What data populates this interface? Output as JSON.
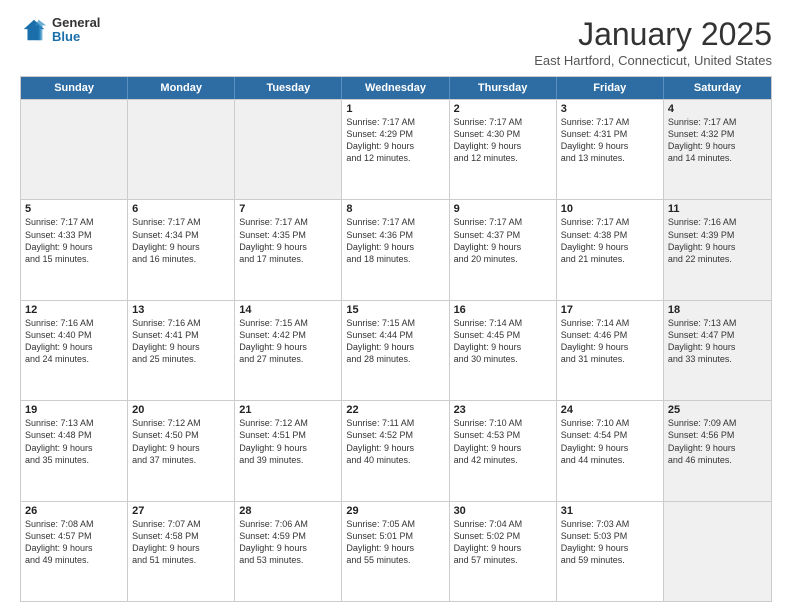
{
  "header": {
    "logo_general": "General",
    "logo_blue": "Blue",
    "month_title": "January 2025",
    "subtitle": "East Hartford, Connecticut, United States"
  },
  "days_of_week": [
    "Sunday",
    "Monday",
    "Tuesday",
    "Wednesday",
    "Thursday",
    "Friday",
    "Saturday"
  ],
  "weeks": [
    [
      {
        "num": "",
        "info": "",
        "shaded": true
      },
      {
        "num": "",
        "info": "",
        "shaded": true
      },
      {
        "num": "",
        "info": "",
        "shaded": true
      },
      {
        "num": "1",
        "info": "Sunrise: 7:17 AM\nSunset: 4:29 PM\nDaylight: 9 hours\nand 12 minutes.",
        "shaded": false
      },
      {
        "num": "2",
        "info": "Sunrise: 7:17 AM\nSunset: 4:30 PM\nDaylight: 9 hours\nand 12 minutes.",
        "shaded": false
      },
      {
        "num": "3",
        "info": "Sunrise: 7:17 AM\nSunset: 4:31 PM\nDaylight: 9 hours\nand 13 minutes.",
        "shaded": false
      },
      {
        "num": "4",
        "info": "Sunrise: 7:17 AM\nSunset: 4:32 PM\nDaylight: 9 hours\nand 14 minutes.",
        "shaded": true
      }
    ],
    [
      {
        "num": "5",
        "info": "Sunrise: 7:17 AM\nSunset: 4:33 PM\nDaylight: 9 hours\nand 15 minutes.",
        "shaded": false
      },
      {
        "num": "6",
        "info": "Sunrise: 7:17 AM\nSunset: 4:34 PM\nDaylight: 9 hours\nand 16 minutes.",
        "shaded": false
      },
      {
        "num": "7",
        "info": "Sunrise: 7:17 AM\nSunset: 4:35 PM\nDaylight: 9 hours\nand 17 minutes.",
        "shaded": false
      },
      {
        "num": "8",
        "info": "Sunrise: 7:17 AM\nSunset: 4:36 PM\nDaylight: 9 hours\nand 18 minutes.",
        "shaded": false
      },
      {
        "num": "9",
        "info": "Sunrise: 7:17 AM\nSunset: 4:37 PM\nDaylight: 9 hours\nand 20 minutes.",
        "shaded": false
      },
      {
        "num": "10",
        "info": "Sunrise: 7:17 AM\nSunset: 4:38 PM\nDaylight: 9 hours\nand 21 minutes.",
        "shaded": false
      },
      {
        "num": "11",
        "info": "Sunrise: 7:16 AM\nSunset: 4:39 PM\nDaylight: 9 hours\nand 22 minutes.",
        "shaded": true
      }
    ],
    [
      {
        "num": "12",
        "info": "Sunrise: 7:16 AM\nSunset: 4:40 PM\nDaylight: 9 hours\nand 24 minutes.",
        "shaded": false
      },
      {
        "num": "13",
        "info": "Sunrise: 7:16 AM\nSunset: 4:41 PM\nDaylight: 9 hours\nand 25 minutes.",
        "shaded": false
      },
      {
        "num": "14",
        "info": "Sunrise: 7:15 AM\nSunset: 4:42 PM\nDaylight: 9 hours\nand 27 minutes.",
        "shaded": false
      },
      {
        "num": "15",
        "info": "Sunrise: 7:15 AM\nSunset: 4:44 PM\nDaylight: 9 hours\nand 28 minutes.",
        "shaded": false
      },
      {
        "num": "16",
        "info": "Sunrise: 7:14 AM\nSunset: 4:45 PM\nDaylight: 9 hours\nand 30 minutes.",
        "shaded": false
      },
      {
        "num": "17",
        "info": "Sunrise: 7:14 AM\nSunset: 4:46 PM\nDaylight: 9 hours\nand 31 minutes.",
        "shaded": false
      },
      {
        "num": "18",
        "info": "Sunrise: 7:13 AM\nSunset: 4:47 PM\nDaylight: 9 hours\nand 33 minutes.",
        "shaded": true
      }
    ],
    [
      {
        "num": "19",
        "info": "Sunrise: 7:13 AM\nSunset: 4:48 PM\nDaylight: 9 hours\nand 35 minutes.",
        "shaded": false
      },
      {
        "num": "20",
        "info": "Sunrise: 7:12 AM\nSunset: 4:50 PM\nDaylight: 9 hours\nand 37 minutes.",
        "shaded": false
      },
      {
        "num": "21",
        "info": "Sunrise: 7:12 AM\nSunset: 4:51 PM\nDaylight: 9 hours\nand 39 minutes.",
        "shaded": false
      },
      {
        "num": "22",
        "info": "Sunrise: 7:11 AM\nSunset: 4:52 PM\nDaylight: 9 hours\nand 40 minutes.",
        "shaded": false
      },
      {
        "num": "23",
        "info": "Sunrise: 7:10 AM\nSunset: 4:53 PM\nDaylight: 9 hours\nand 42 minutes.",
        "shaded": false
      },
      {
        "num": "24",
        "info": "Sunrise: 7:10 AM\nSunset: 4:54 PM\nDaylight: 9 hours\nand 44 minutes.",
        "shaded": false
      },
      {
        "num": "25",
        "info": "Sunrise: 7:09 AM\nSunset: 4:56 PM\nDaylight: 9 hours\nand 46 minutes.",
        "shaded": true
      }
    ],
    [
      {
        "num": "26",
        "info": "Sunrise: 7:08 AM\nSunset: 4:57 PM\nDaylight: 9 hours\nand 49 minutes.",
        "shaded": false
      },
      {
        "num": "27",
        "info": "Sunrise: 7:07 AM\nSunset: 4:58 PM\nDaylight: 9 hours\nand 51 minutes.",
        "shaded": false
      },
      {
        "num": "28",
        "info": "Sunrise: 7:06 AM\nSunset: 4:59 PM\nDaylight: 9 hours\nand 53 minutes.",
        "shaded": false
      },
      {
        "num": "29",
        "info": "Sunrise: 7:05 AM\nSunset: 5:01 PM\nDaylight: 9 hours\nand 55 minutes.",
        "shaded": false
      },
      {
        "num": "30",
        "info": "Sunrise: 7:04 AM\nSunset: 5:02 PM\nDaylight: 9 hours\nand 57 minutes.",
        "shaded": false
      },
      {
        "num": "31",
        "info": "Sunrise: 7:03 AM\nSunset: 5:03 PM\nDaylight: 9 hours\nand 59 minutes.",
        "shaded": false
      },
      {
        "num": "",
        "info": "",
        "shaded": true
      }
    ]
  ]
}
